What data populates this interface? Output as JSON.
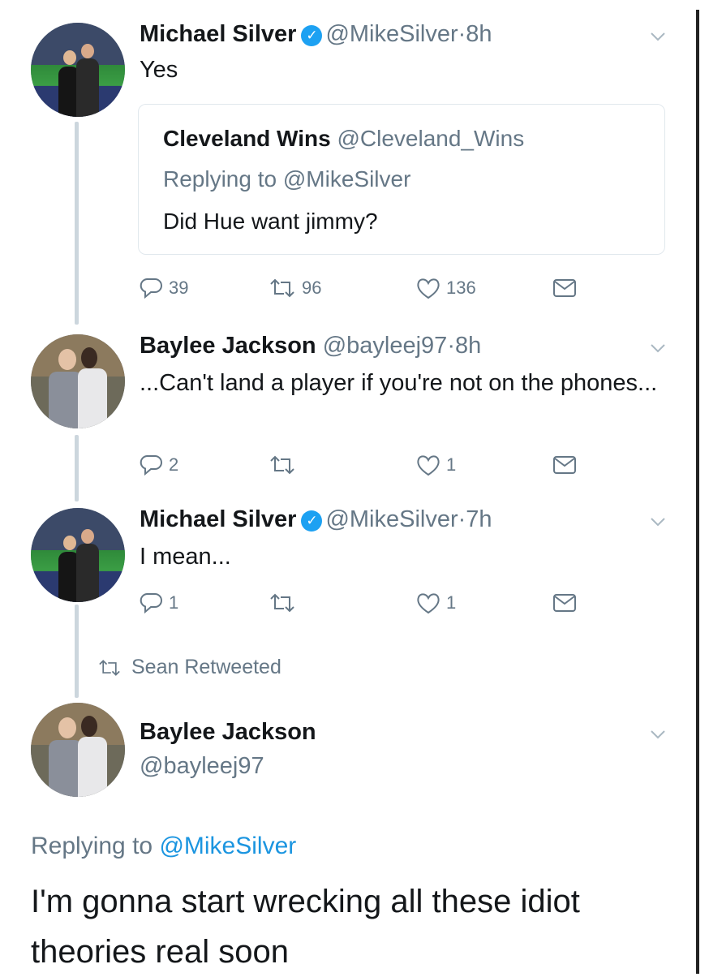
{
  "tweets": [
    {
      "name": "Michael Silver",
      "handle": "@MikeSilver",
      "time": "8h",
      "text": "Yes",
      "quote": {
        "name": "Cleveland Wins",
        "handle": "@Cleveland_Wins",
        "replying_to": "Replying to @MikeSilver",
        "text": "Did Hue want jimmy?"
      },
      "replies": "39",
      "retweets": "96",
      "likes": "136"
    },
    {
      "name": "Baylee Jackson",
      "handle": "@bayleej97",
      "time": "8h",
      "text": "...Can't land a player if you're not on the phones...",
      "replies": "2",
      "retweets": "",
      "likes": "1"
    },
    {
      "name": "Michael Silver",
      "handle": "@MikeSilver",
      "time": "7h",
      "text": "I mean...",
      "replies": "1",
      "retweets": "",
      "likes": "1"
    }
  ],
  "retweet_notice": "Sean Retweeted",
  "main_tweet": {
    "name": "Baylee Jackson",
    "handle": "@bayleej97",
    "replying_prefix": "Replying to",
    "replying_mention": "@MikeSilver",
    "text": "I'm gonna start wrecking all these idiot theories real soon"
  },
  "separator": "·",
  "icons": [
    "reply-icon",
    "retweet-icon",
    "like-icon",
    "dm-icon",
    "verified-badge-icon",
    "chevron-down-icon"
  ],
  "colors": {
    "text": "#14171a",
    "muted": "#657786",
    "verified": "#1da1f2",
    "link": "#1b95e0",
    "thread_line": "#ccd6dd"
  }
}
